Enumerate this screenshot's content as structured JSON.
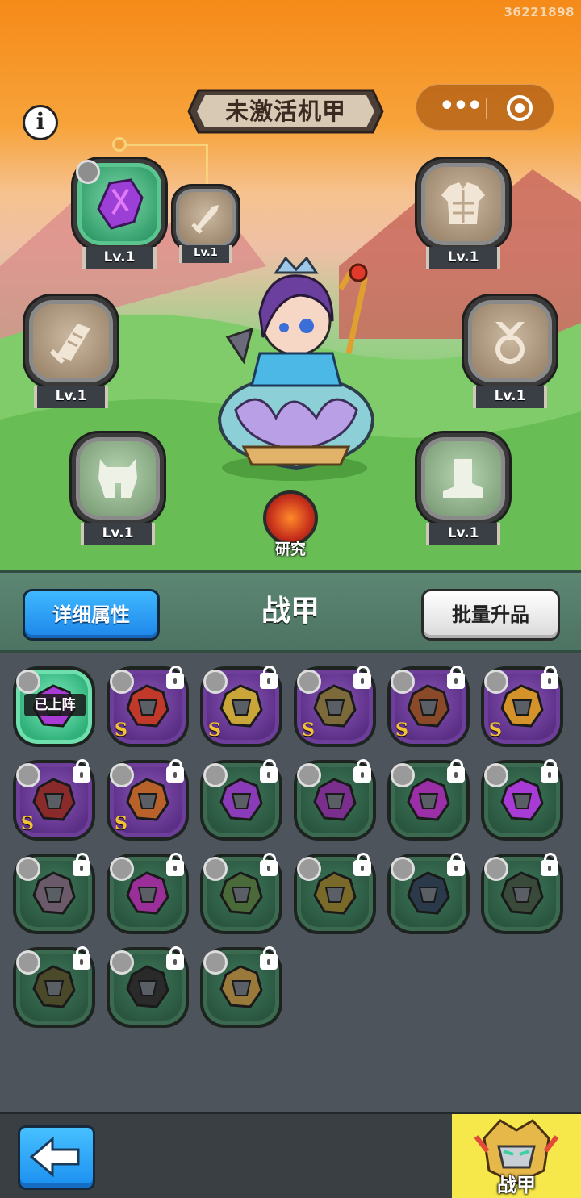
{
  "uid": "36221898",
  "header": {
    "title": "未激活机甲"
  },
  "capsule": {
    "more_icon": "more-dots-icon",
    "close_icon": "target-close-icon"
  },
  "info_icon": "info-icon",
  "slots": {
    "weapon_left": {
      "level": "Lv.1",
      "icon": "purple-crystal-icon",
      "state": "equipped"
    },
    "weapon_small": {
      "level": "Lv.1",
      "icon": "sword-icon"
    },
    "armor": {
      "level": "Lv.1",
      "icon": "armor-icon"
    },
    "scroll": {
      "level": "Lv.1",
      "icon": "scroll-icon"
    },
    "medal": {
      "level": "Lv.1",
      "icon": "medal-icon"
    },
    "helmet": {
      "level": "Lv.1",
      "icon": "helmet-icon"
    },
    "boots": {
      "level": "Lv.1",
      "icon": "boot-icon"
    }
  },
  "research": {
    "label": "研究"
  },
  "bar": {
    "detail_label": "详细属性",
    "title": "战甲",
    "batch_label": "批量升品"
  },
  "grid": {
    "cells": [
      {
        "rarity": "active",
        "tag": "已上阵",
        "locked": false
      },
      {
        "rarity": "purple",
        "grade": "S",
        "locked": true
      },
      {
        "rarity": "purple",
        "grade": "S",
        "locked": true
      },
      {
        "rarity": "purple",
        "grade": "S",
        "locked": true
      },
      {
        "rarity": "purple",
        "grade": "S",
        "locked": true
      },
      {
        "rarity": "purple",
        "grade": "S",
        "locked": true
      },
      {
        "rarity": "purple",
        "grade": "S",
        "locked": true
      },
      {
        "rarity": "purple",
        "grade": "S",
        "locked": true
      },
      {
        "rarity": "green",
        "locked": true
      },
      {
        "rarity": "green",
        "locked": true
      },
      {
        "rarity": "green",
        "locked": true
      },
      {
        "rarity": "green",
        "locked": true
      },
      {
        "rarity": "green",
        "locked": true
      },
      {
        "rarity": "green",
        "locked": true
      },
      {
        "rarity": "green",
        "locked": true
      },
      {
        "rarity": "green",
        "locked": true
      },
      {
        "rarity": "green",
        "locked": true
      },
      {
        "rarity": "green",
        "locked": true
      },
      {
        "rarity": "green",
        "locked": true
      },
      {
        "rarity": "green",
        "locked": true
      },
      {
        "rarity": "green",
        "locked": true
      }
    ]
  },
  "footer": {
    "back_icon": "back-arrow-icon",
    "mech_tab_label": "战甲"
  },
  "colors": {
    "accent_blue": "#1e86ea",
    "bar_green": "#4d7363",
    "tab_yellow": "#f6e84a",
    "grade_gold": "#f2c230"
  }
}
